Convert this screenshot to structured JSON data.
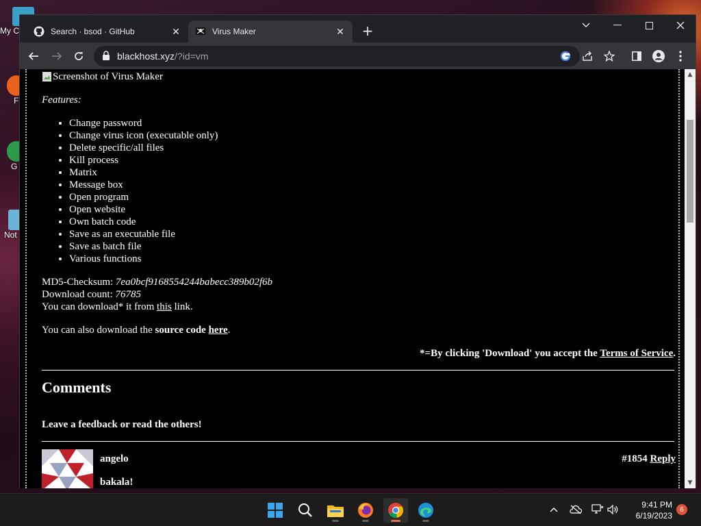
{
  "desktop": {
    "icons": [
      {
        "label": "My C",
        "name": "desktop-icon-my-computer"
      },
      {
        "label": "F",
        "name": "desktop-icon-f"
      },
      {
        "label": "G Cl",
        "name": "desktop-icon-google-chrome"
      },
      {
        "label": "Not",
        "name": "desktop-icon-notepad"
      }
    ]
  },
  "browser": {
    "tabs": [
      {
        "title": "Search · bsod · GitHub",
        "favicon": "github-icon",
        "active": false
      },
      {
        "title": "Virus Maker",
        "favicon": "pirate-flag-icon",
        "active": true
      }
    ],
    "address": {
      "host": "blackhost.xyz",
      "path": "/?id=vm"
    }
  },
  "page": {
    "screenshot_alt": "Screenshot of Virus Maker",
    "features_label": "Features:",
    "features": [
      "Change password",
      "Change virus icon (executable only)",
      "Delete specific/all files",
      "Kill process",
      "Matrix",
      "Message box",
      "Open program",
      "Open website",
      "Own batch code",
      "Save as an executable file",
      "Save as batch file",
      "Various functions"
    ],
    "checksum_label": "MD5-Checksum: ",
    "checksum_value": "7ea0bcf9168554244babecc389b02f6b",
    "download_count_label": "Download count: ",
    "download_count_value": "76785",
    "download_prefix": "You can download* it from ",
    "download_link": "this",
    "download_suffix": " link.",
    "source_prefix": "You can also download the ",
    "source_bold": "source code",
    "source_space": " ",
    "source_link": "here",
    "source_suffix": ".",
    "tos_prefix": "*=By clicking 'Download' you accept the ",
    "tos_link": "Terms of Service",
    "tos_suffix": ".",
    "comments_heading": "Comments",
    "comments_sub": "Leave a feedback or read the others!",
    "comments": [
      {
        "author": "angelo",
        "number": "#1854",
        "reply": "Reply",
        "body": "bakala!"
      }
    ]
  },
  "taskbar": {
    "apps": [
      "windows-start",
      "search",
      "file-explorer",
      "firefox",
      "chrome",
      "edge"
    ],
    "time": "9:41 PM",
    "date": "6/19/2023",
    "notifications": "6"
  },
  "colors": {
    "page_bg": "#000000",
    "text": "#ffffff",
    "tab_active": "#35363a",
    "chrome_bg": "#202124"
  }
}
